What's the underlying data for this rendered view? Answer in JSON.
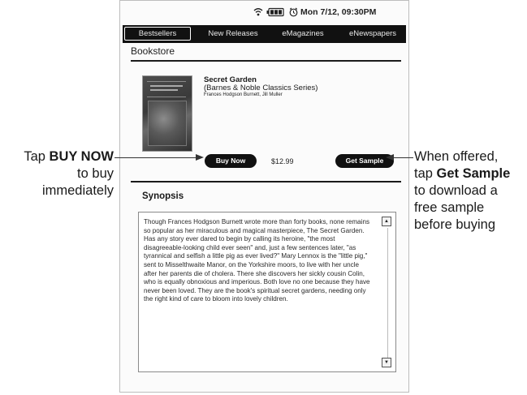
{
  "status_bar": {
    "wifi_icon": "wifi-icon",
    "battery_icon": "battery-icon",
    "clock_icon": "clock-icon",
    "datetime": "Mon 7/12, 09:30PM"
  },
  "tabs": [
    {
      "label": "Bestsellers",
      "active": true
    },
    {
      "label": "New Releases",
      "active": false
    },
    {
      "label": "eMagazines",
      "active": false
    },
    {
      "label": "eNewspapers",
      "active": false
    }
  ],
  "page_title": "Bookstore",
  "book": {
    "title": "Secret Garden",
    "series": "(Barnes & Noble Classics Series)",
    "authors": "Frances Hodgson Burnett, Jill Muller",
    "price": "$12.99"
  },
  "buttons": {
    "buy_now": "Buy Now",
    "get_sample": "Get Sample"
  },
  "synopsis": {
    "heading": "Synopsis",
    "text": "Though Frances Hodgson Burnett wrote more than forty books, none remains so popular as her miraculous and magical masterpiece, The Secret Garden. Has any story ever dared to begin by calling its heroine, \"the most disagreeable-looking child ever seen\" and, just a few sentences later, \"as tyrannical and selfish a little pig as ever lived?\" Mary Lennox is the \"little pig,\" sent to Misselthwaite Manor, on the Yorkshire moors, to live with her uncle after her parents die of cholera. There she discovers her sickly cousin Colin, who is equally obnoxious and imperious. Both love no one because they have never been loved. They are the book's spiritual secret gardens, needing only the right kind of care to bloom into lovely children."
  },
  "callouts": {
    "left": {
      "prefix": "Tap ",
      "bold": "BUY NOW",
      "line2": "to buy",
      "line3": "immediately"
    },
    "right": {
      "line1": "When offered,",
      "prefix": "tap ",
      "bold": "Get Sample",
      "line3": "to download a",
      "line4": "free sample",
      "line5": "before buying"
    }
  }
}
